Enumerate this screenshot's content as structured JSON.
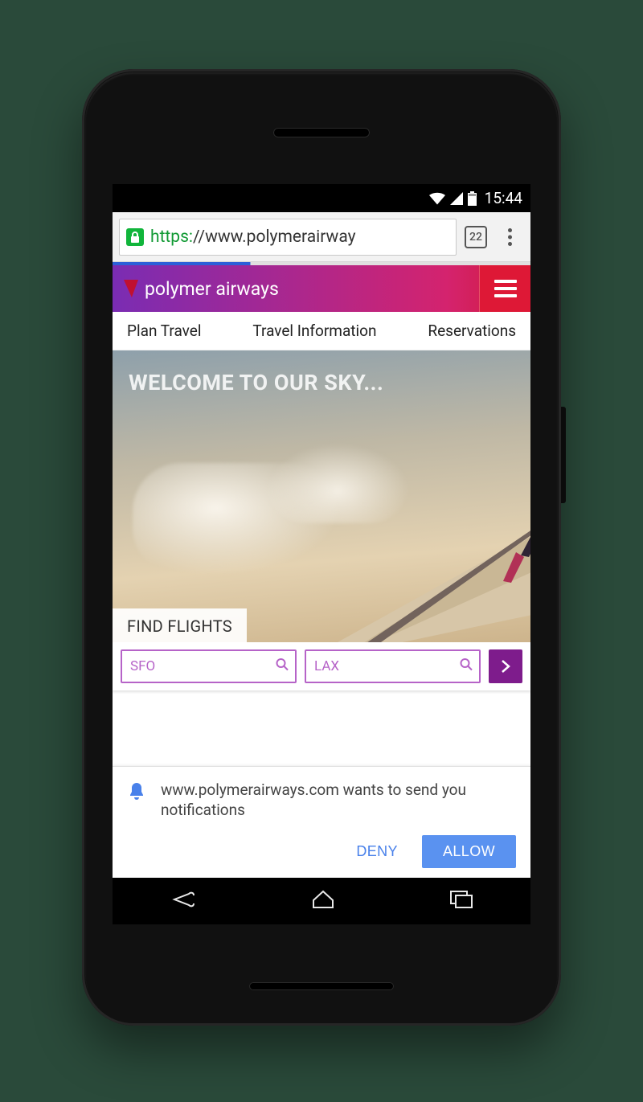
{
  "status_bar": {
    "time": "15:44"
  },
  "chrome": {
    "url_scheme": "https:",
    "url_rest": "//www.polymerairway",
    "tab_count": "22"
  },
  "site": {
    "brand": "polymer airways",
    "nav": {
      "plan": "Plan Travel",
      "info": "Travel Information",
      "reservations": "Reservations"
    },
    "hero_title": "WELCOME TO OUR SKY...",
    "find_flights_label": "FIND FLIGHTS",
    "search": {
      "from_placeholder": "SFO",
      "to_placeholder": "LAX"
    }
  },
  "notification_prompt": {
    "message": "www.polymerairways.com wants to send you notifications",
    "deny_label": "DENY",
    "allow_label": "ALLOW"
  }
}
